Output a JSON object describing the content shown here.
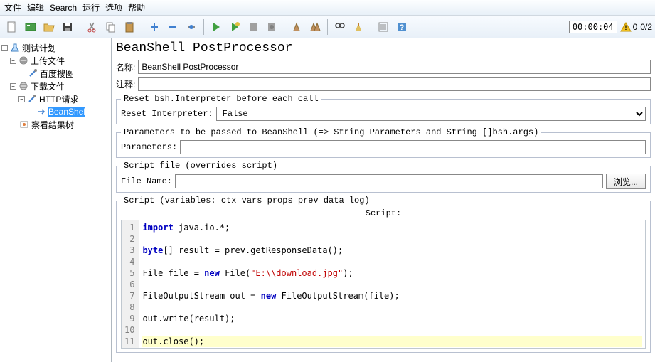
{
  "menu": [
    "文件",
    "编辑",
    "Search",
    "运行",
    "选项",
    "帮助"
  ],
  "timer": "00:00:04",
  "warn_count": "0",
  "err_count": "0/2",
  "tree": {
    "root": "测试计划",
    "n1": "上传文件",
    "n1a": "百度搜图",
    "n2": "下载文件",
    "n2a": "HTTP请求",
    "n2a1": "BeanShel",
    "n3": "察看结果树"
  },
  "panel": {
    "title": "BeanShell PostProcessor",
    "name_label": "名称:",
    "name_value": "BeanShell PostProcessor",
    "comment_label": "注释:",
    "comment_value": "",
    "fs1_legend": "Reset bsh.Interpreter before each call",
    "reset_label": "Reset Interpreter:",
    "reset_value": "False",
    "fs2_legend": "Parameters to be passed to BeanShell (=> String Parameters and String []bsh.args)",
    "params_label": "Parameters:",
    "params_value": "",
    "fs3_legend": "Script file (overrides script)",
    "file_label": "File Name:",
    "file_value": "",
    "browse": "浏览...",
    "fs4_legend": "Script (variables: ctx vars props prev data log)",
    "script_label": "Script:"
  },
  "code": {
    "lines": [
      {
        "n": "1",
        "tokens": [
          {
            "t": "import ",
            "c": "kw"
          },
          {
            "t": "java.io.*;"
          }
        ]
      },
      {
        "n": "2",
        "tokens": []
      },
      {
        "n": "3",
        "tokens": [
          {
            "t": "byte",
            "c": "kw"
          },
          {
            "t": "[] result = prev.getResponseData();"
          }
        ]
      },
      {
        "n": "4",
        "tokens": []
      },
      {
        "n": "5",
        "tokens": [
          {
            "t": "File file = "
          },
          {
            "t": "new ",
            "c": "kw"
          },
          {
            "t": "File("
          },
          {
            "t": "\"E:\\\\download.jpg\"",
            "c": "str"
          },
          {
            "t": ");"
          }
        ]
      },
      {
        "n": "6",
        "tokens": []
      },
      {
        "n": "7",
        "tokens": [
          {
            "t": "FileOutputStream out = "
          },
          {
            "t": "new ",
            "c": "kw"
          },
          {
            "t": "FileOutputStream(file);"
          }
        ]
      },
      {
        "n": "8",
        "tokens": []
      },
      {
        "n": "9",
        "tokens": [
          {
            "t": "out.write(result);"
          }
        ]
      },
      {
        "n": "10",
        "tokens": []
      },
      {
        "n": "11",
        "tokens": [
          {
            "t": "out.close();"
          }
        ],
        "hl": true
      }
    ]
  }
}
